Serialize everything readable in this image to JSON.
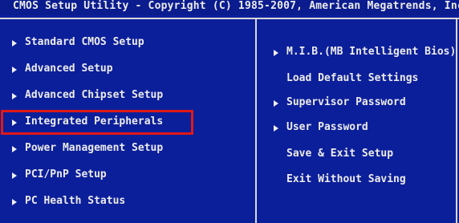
{
  "title": "CMOS Setup Utility - Copyright (C) 1985-2007, American Megatrends, Inc.",
  "colors": {
    "background": "#0c1f9a",
    "text": "#ececec",
    "border": "#d8d8d8",
    "highlight": "#e01818"
  },
  "left_menu": [
    {
      "label": "Standard CMOS Setup",
      "submenu": true
    },
    {
      "label": "Advanced Setup",
      "submenu": true
    },
    {
      "label": "Advanced Chipset Setup",
      "submenu": true
    },
    {
      "label": "Integrated Peripherals",
      "submenu": true,
      "selected": true
    },
    {
      "label": "Power Management Setup",
      "submenu": true
    },
    {
      "label": "PCI/PnP Setup",
      "submenu": true
    },
    {
      "label": "PC Health Status",
      "submenu": true
    }
  ],
  "right_menu": [
    {
      "label": "M.I.B.(MB Intelligent Bios)",
      "submenu": true
    },
    {
      "label": "Load Default Settings",
      "submenu": false
    },
    {
      "label": "Supervisor Password",
      "submenu": true
    },
    {
      "label": "User Password",
      "submenu": true
    },
    {
      "label": "Save & Exit Setup",
      "submenu": false
    },
    {
      "label": "Exit Without Saving",
      "submenu": false
    }
  ]
}
